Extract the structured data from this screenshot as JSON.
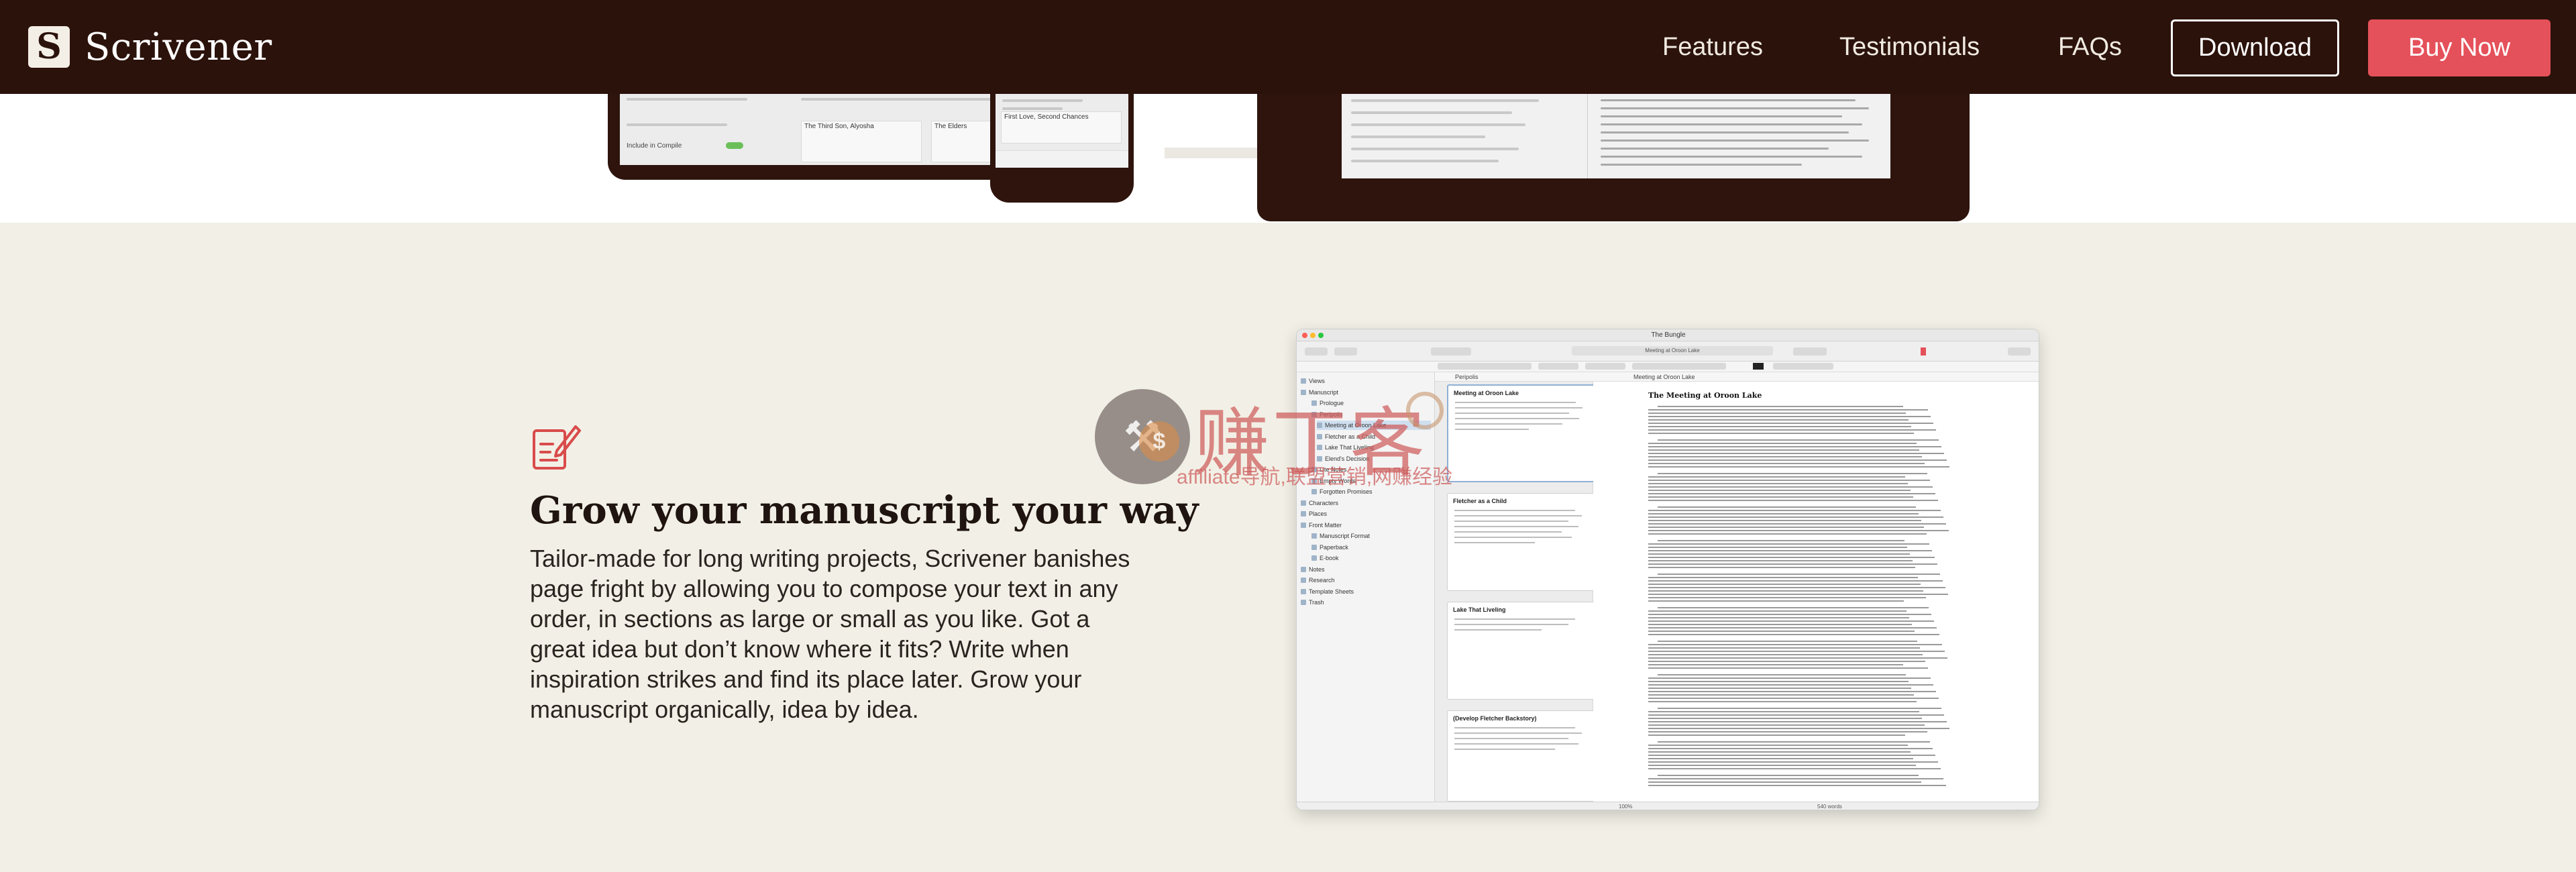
{
  "nav": {
    "brand_mark": "S",
    "brand_name": "Scrivener",
    "links": [
      "Features",
      "Testimonials",
      "FAQs"
    ],
    "download_label": "Download",
    "buy_label": "Buy Now"
  },
  "section": {
    "heading": "Grow your manuscript your way",
    "body": "Tailor-made for long writing projects, Scrivener banishes page fright by allowing you to compose your text in any order, in sections as large or small as you like. Got a great idea but don’t know where it fits? Write when inspiration strikes and find its place later. Grow your manuscript organically, idea by idea."
  },
  "app": {
    "window_title": "The Bungle",
    "tab_title": "Meeting at Oroon Lake",
    "corkboard_header": "Peripolis",
    "editor_header": "Meeting at Oroon Lake",
    "binder": [
      "Views",
      "Manuscript",
      "Prologue",
      "Peripolis",
      "Meeting at Oroon Lake",
      "Fletcher as a Child",
      "Lake That Liveling",
      "Elend's Decision",
      "Lite Notes",
      "Empty Words",
      "Forgotten Promises",
      "Characters",
      "Places",
      "Front Matter",
      "Manuscript Format",
      "Paperback",
      "E-book",
      "Notes",
      "Research",
      "Template Sheets",
      "Trash"
    ],
    "cards": [
      {
        "title": "Meeting at Oroon Lake"
      },
      {
        "title": "Fletcher as a Child"
      },
      {
        "title": "Lake That Liveling"
      },
      {
        "title": "(Develop Fletcher Backstory)"
      }
    ],
    "doc_title": "The Meeting at Oroon Lake",
    "status_zoom": "100%",
    "status_words": "540 words"
  },
  "device_snippets": {
    "card_a": "The Third Son, Alyosha",
    "card_b": "The Elders",
    "card_c": "First Love, Second Chances",
    "sidebar_label": "Include in Compile"
  },
  "watermark": {
    "big": "赚丁客",
    "small": "affiliate导航,联盟营销,网赚经验",
    "glyph": "⚒",
    "coin": "$"
  },
  "colors": {
    "nav_bg": "#2b120b",
    "accent": "#e5515a",
    "section_bg": "#f2f0e6",
    "icon": "#d94b4b"
  }
}
